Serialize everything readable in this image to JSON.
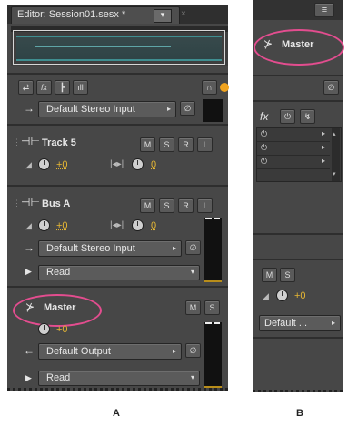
{
  "panel_a": {
    "tab_title": "Editor: Session01.sesx *",
    "tab_menu_glyph": "▾",
    "toolbar_icons": [
      "routing-icon",
      "fx-icon",
      "sends-icon",
      "eq-icon",
      "headphone-icon"
    ],
    "fx_label": "fx",
    "top_input": "Default Stereo Input",
    "track5": {
      "name": "Track 5",
      "m": "M",
      "s": "S",
      "r": "R",
      "i": "I",
      "volume": "+0",
      "pan": "0"
    },
    "busA": {
      "name": "Bus A",
      "m": "M",
      "s": "S",
      "r": "R",
      "i": "I",
      "volume": "+0",
      "pan": "0",
      "input": "Default Stereo Input",
      "automation": "Read"
    },
    "master": {
      "name": "Master",
      "m": "M",
      "s": "S",
      "volume": "+0",
      "output": "Default Output",
      "automation": "Read"
    },
    "caption": "A"
  },
  "panel_b": {
    "menu_glyph": "≡",
    "master_name": "Master",
    "fx_label": "fx",
    "m": "M",
    "s": "S",
    "volume": "+0",
    "output": "Default ...",
    "caption": "B"
  },
  "colors": {
    "highlight": "#e34d8f",
    "accent": "#e5b633",
    "panel": "#474747"
  }
}
